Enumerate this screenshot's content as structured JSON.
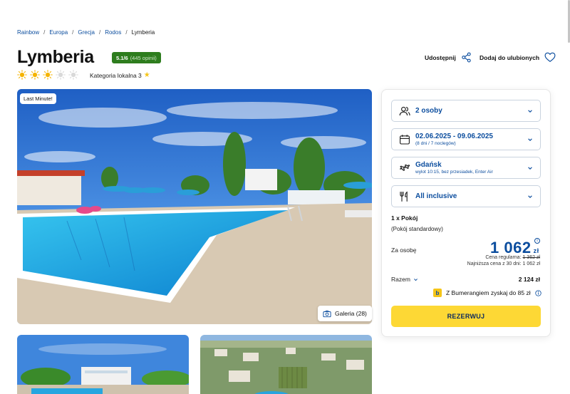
{
  "breadcrumb": {
    "items": [
      "Rainbow",
      "Europa",
      "Grecja",
      "Rodos"
    ],
    "current": "Lymberia",
    "separator": "/"
  },
  "hotel": {
    "name": "Lymberia",
    "rating": "5.1/6",
    "reviews": "(445 opinii)",
    "suns_filled": 3,
    "suns_total": 5,
    "category_label": "Kategoria lokalna 3"
  },
  "actions": {
    "share_label": "Udostępnij",
    "favorite_label": "Dodaj do ulubionych"
  },
  "gallery": {
    "badge": "Last Minute!",
    "button_label": "Galeria (28)"
  },
  "booking": {
    "persons": "2 osoby",
    "dates": "02.06.2025 - 09.06.2025",
    "dates_sub": "(8 dni / 7 noclegów)",
    "departure": "Gdańsk",
    "departure_sub": "wylot 10:15, bez przesiadek, Enter Air",
    "board": "All inclusive",
    "room_qty": "1 x Pokój",
    "room_type": "(Pokój standardowy)",
    "per_person_label": "Za osobę",
    "price": "1 062",
    "currency": "zł",
    "regular_label": "Cena regularna:",
    "regular_price": "1 362 zł",
    "lowest_30": "Najniższa cena z 30 dni: 1 062 zł",
    "total_label": "Razem",
    "total_value": "2 124 zł",
    "bumerang_text": "Z Bumerangiem zyskaj do 85 zł",
    "reserve_label": "REZERWUJ"
  },
  "colors": {
    "brand_blue": "#0b4d9e",
    "rating_green": "#2e7d1e",
    "reserve_yellow": "#fdd835",
    "sun_filled": "#f5b400",
    "sun_empty": "#d9d9d9"
  }
}
